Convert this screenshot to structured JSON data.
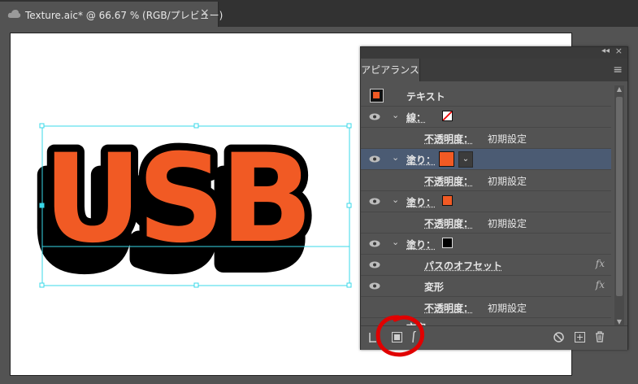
{
  "tab": {
    "title": "Texture.aic* @ 66.67 % (RGB/プレビュー)",
    "close": "×"
  },
  "artwork": {
    "text": "USB",
    "fill_color": "#f15a24",
    "stroke_color": "#000000"
  },
  "panel": {
    "tab_label": "アピアランス",
    "collapse": "◂◂",
    "close": "×",
    "menu": "≡",
    "rows": [
      {
        "label": "テキスト"
      },
      {
        "label": "線：",
        "swatch": "none"
      },
      {
        "label": "不透明度：",
        "value": "初期設定"
      },
      {
        "label": "塗り：",
        "swatch": "#f15a24",
        "selected": true
      },
      {
        "label": "不透明度：",
        "value": "初期設定"
      },
      {
        "label": "塗り：",
        "swatch": "#f15a24"
      },
      {
        "label": "不透明度：",
        "value": "初期設定"
      },
      {
        "label": "塗り：",
        "swatch": "#000000"
      },
      {
        "label": "パスのオフセット",
        "fx": "fx"
      },
      {
        "label": "変形",
        "fx": "fx"
      },
      {
        "label": "不透明度：",
        "value": "初期設定"
      },
      {
        "label": "文字"
      }
    ]
  },
  "colors": {
    "selection": "#4b5b73",
    "bounding_box": "#38d8e8",
    "highlight_circle": "#e00000"
  }
}
